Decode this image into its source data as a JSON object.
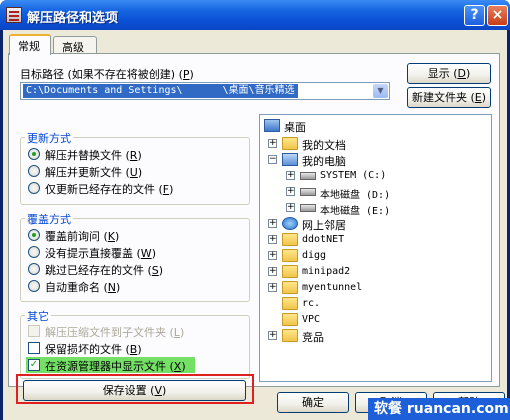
{
  "window": {
    "title": "解压路径和选项",
    "help_icon": "?",
    "close_icon": "×"
  },
  "tabs": [
    {
      "label": "常规",
      "active": true
    },
    {
      "label": "高级",
      "active": false
    }
  ],
  "target": {
    "label_pre": "目标路径 (如果不存在将被创建) (",
    "label_key": "P",
    "label_post": ")",
    "path": "C:\\Documents and Settings\\　　　　\\桌面\\音乐精选"
  },
  "buttons": {
    "show_pre": "显示 (",
    "show_key": "D",
    "show_post": ")",
    "newfolder_pre": "新建文件夹 (",
    "newfolder_key": "E",
    "newfolder_post": ")",
    "save_pre": "保存设置 (",
    "save_key": "V",
    "save_post": ")",
    "ok": "确定",
    "cancel": "取消",
    "help": "帮助"
  },
  "update_group": {
    "title": "更新方式",
    "options": [
      {
        "pre": "解压并替换文件 (",
        "key": "R",
        "post": ")",
        "selected": true
      },
      {
        "pre": "解压并更新文件 (",
        "key": "U",
        "post": ")",
        "selected": false
      },
      {
        "pre": "仅更新已经存在的文件 (",
        "key": "F",
        "post": ")",
        "selected": false
      }
    ]
  },
  "overwrite_group": {
    "title": "覆盖方式",
    "options": [
      {
        "pre": "覆盖前询问 (",
        "key": "K",
        "post": ")",
        "selected": true
      },
      {
        "pre": "没有提示直接覆盖 (",
        "key": "W",
        "post": ")",
        "selected": false
      },
      {
        "pre": "跳过已经存在的文件 (",
        "key": "S",
        "post": ")",
        "selected": false
      },
      {
        "pre": "自动重命名 (",
        "key": "N",
        "post": ")",
        "selected": false
      }
    ]
  },
  "misc_group": {
    "title": "其它",
    "options": [
      {
        "pre": "解压压缩文件到子文件夹 (",
        "key": "L",
        "post": ")",
        "checked": false,
        "disabled": true
      },
      {
        "pre": "保留损坏的文件 (",
        "key": "B",
        "post": ")",
        "checked": false,
        "disabled": false
      },
      {
        "pre": "在资源管理器中显示文件 (",
        "key": "X",
        "post": ")",
        "checked": true,
        "disabled": false
      }
    ]
  },
  "tree": {
    "root": "桌面",
    "nodes": [
      {
        "label": "我的文档",
        "icon": "folder-icon",
        "expander": "+"
      },
      {
        "label": "我的电脑",
        "icon": "computer-icon",
        "expander": "−"
      },
      {
        "label": "SYSTEM (C:)",
        "icon": "drive-icon",
        "expander": "+"
      },
      {
        "label": "本地磁盘 (D:)",
        "icon": "drive-icon",
        "expander": "+"
      },
      {
        "label": "本地磁盘 (E:)",
        "icon": "drive-icon",
        "expander": "+"
      },
      {
        "label": "网上邻居",
        "icon": "network-icon",
        "expander": "+"
      },
      {
        "label": "ddotNET",
        "icon": "folder-icon",
        "expander": "+"
      },
      {
        "label": "digg",
        "icon": "folder-icon",
        "expander": "+"
      },
      {
        "label": "minipad2",
        "icon": "folder-icon",
        "expander": "+"
      },
      {
        "label": "myentunnel",
        "icon": "folder-icon",
        "expander": "+"
      },
      {
        "label": "rc.",
        "icon": "folder-icon",
        "expander": ""
      },
      {
        "label": "VPC",
        "icon": "folder-icon",
        "expander": ""
      },
      {
        "label": "竞品",
        "icon": "folder-icon",
        "expander": "+"
      }
    ]
  },
  "watermark": "软餐 ruancan.com",
  "colors": {
    "title_bar": "#0b50d6",
    "group_title": "#0046d5",
    "highlight": "#74e066",
    "annotation_box": "#e02020"
  }
}
